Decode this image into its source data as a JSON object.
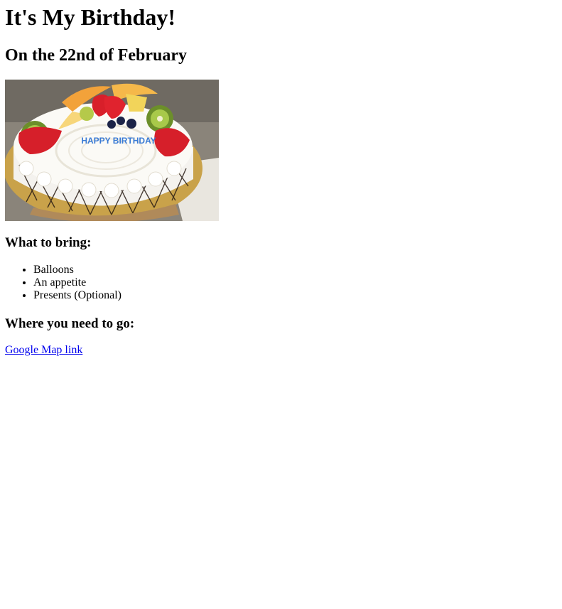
{
  "page": {
    "title": "It's My Birthday!",
    "subtitle": "On the 22nd of February"
  },
  "image": {
    "name": "birthday-cake",
    "cake_text": "HAPPY BIRTHDAY"
  },
  "bring": {
    "heading": "What to bring:",
    "items": [
      {
        "label": "Balloons"
      },
      {
        "label": "An appetite"
      },
      {
        "label": "Presents (Optional)"
      }
    ]
  },
  "location": {
    "heading": "Where you need to go:",
    "link_text": "Google Map link"
  },
  "colors": {
    "link": "#0000ee",
    "text": "#000000",
    "background": "#ffffff"
  }
}
